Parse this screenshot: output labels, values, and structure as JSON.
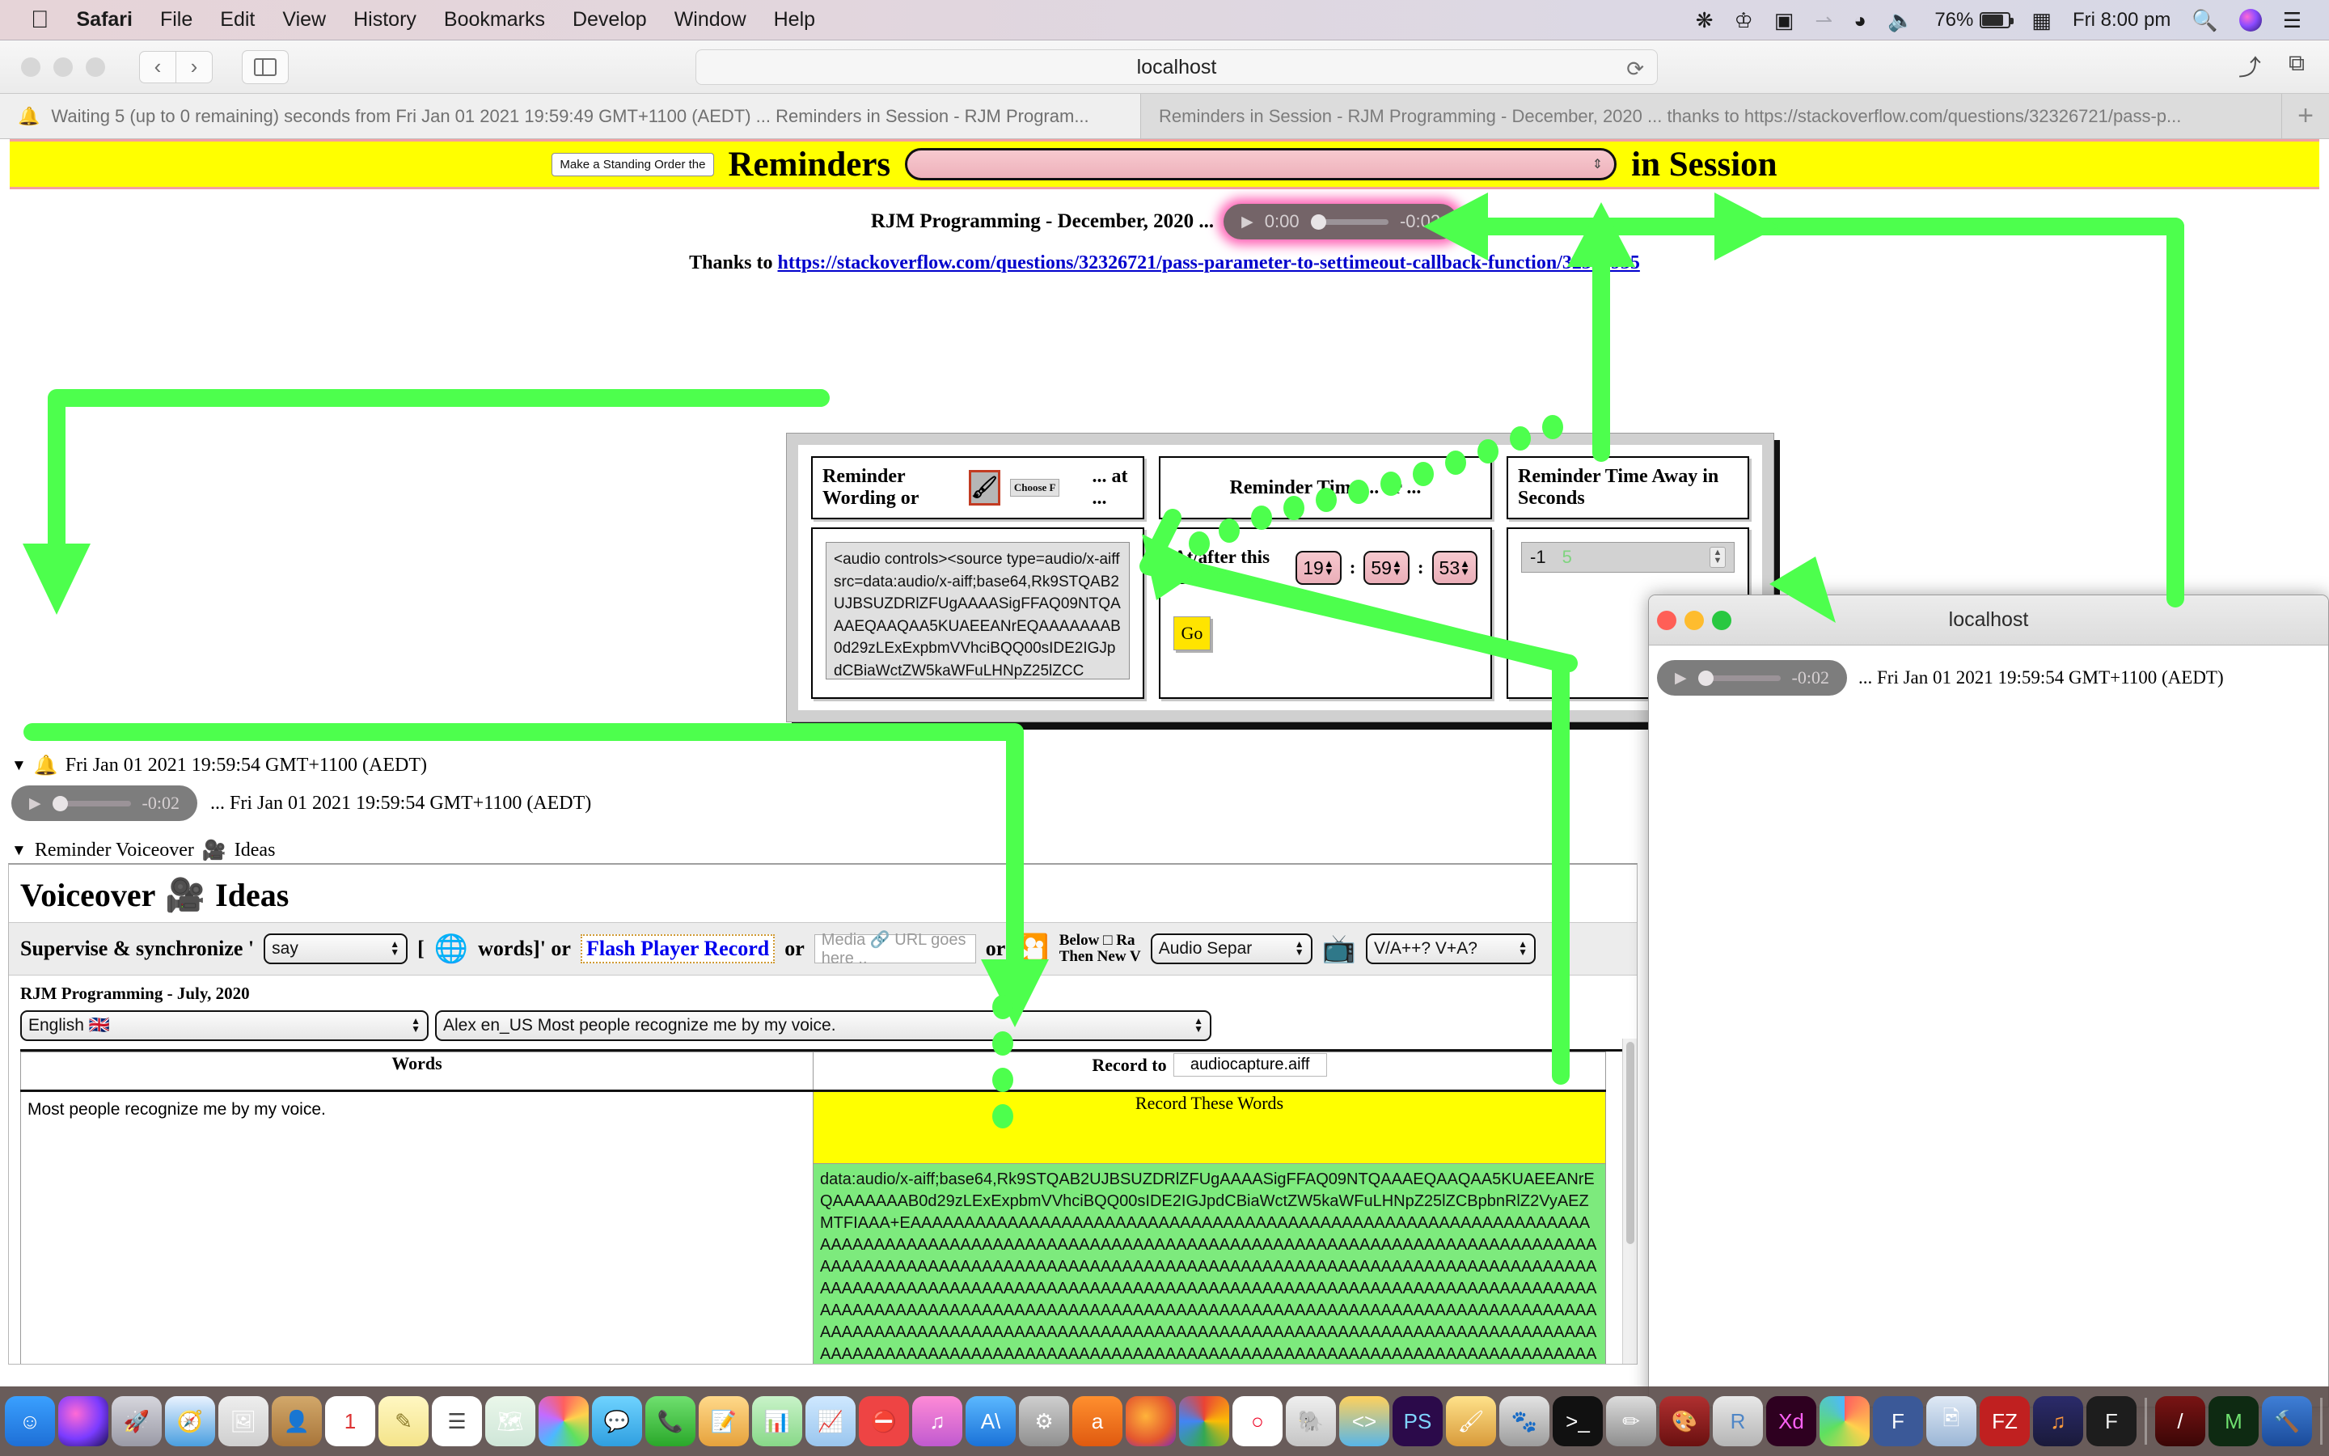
{
  "menubar": {
    "apple": "apple-logo",
    "items": [
      "Safari",
      "File",
      "Edit",
      "View",
      "History",
      "Bookmarks",
      "Develop",
      "Window",
      "Help"
    ],
    "battery_percent": "76%",
    "clock": "Fri 8:00 pm"
  },
  "toolbar": {
    "url": "localhost",
    "reload_glyph": "⟳",
    "back_glyph": "‹",
    "forward_glyph": "›",
    "share_glyph": "⤴",
    "tabs_glyph": "⧉"
  },
  "tabs": [
    {
      "favicon": "🔔",
      "label": "Waiting 5 (up to 0 remaining) seconds from Fri Jan 01 2021 19:59:49 GMT+1100 (AEDT) ... Reminders in Session - RJM Program...",
      "active": true
    },
    {
      "favicon": "",
      "label": "Reminders in Session - RJM Programming - December, 2020 ... thanks to https://stackoverflow.com/questions/32326721/pass-p...",
      "active": false
    }
  ],
  "new_tab_label": "+",
  "header": {
    "standing_order_button": "Make a Standing Order the",
    "title_left": "Reminders",
    "title_right": "in Session",
    "select_value": ""
  },
  "subheader": {
    "rjm_line": "RJM Programming - December, 2020 ...",
    "player": {
      "time_current": "0:00",
      "time_remaining": "-0:02"
    },
    "thanks_prefix": "Thanks to ",
    "thanks_link": "https://stackoverflow.com/questions/32326721/pass-parameter-to-settimeout-callback-function/32326935"
  },
  "panel": {
    "col1": {
      "heading": "Reminder Wording or",
      "brush_icon": "brush-icon",
      "choose_file": "Choose F",
      "at_text": "... at ...",
      "audio_code": "<audio controls><source type=audio/x-aiff src=data:audio/x-aiff;base64,Rk9STQAB2UJBSUZDRlZFUgAAAASigFFAQ09NTQAAAEQAAQAA5KUAEEANrEQAAAAAAAB0d29zLExExpbmVVhciBQQ00sIDE2IGJpdCBiaWctZW5kaWFuLHNpZ25lZCC"
    },
    "col2": {
      "heading": "Reminder Time ... or ...",
      "at_after_label": "At/after this time:",
      "hours": "19",
      "minutes": "59",
      "seconds": "53",
      "go_label": "Go"
    },
    "col3": {
      "heading": "Reminder Time Away in Seconds",
      "value": "-1",
      "placeholder": "5"
    }
  },
  "below": {
    "alarm_icon": "bell-icon",
    "timestamp": "Fri Jan 01 2021 19:59:54 GMT+1100 (AEDT)",
    "player": {
      "time_remaining": "-0:02"
    },
    "player_caption": "... Fri Jan 01 2021 19:59:54 GMT+1100 (AEDT)",
    "voiceover_toggle_prefix": "Reminder Voiceover",
    "voiceover_toggle_suffix": "Ideas",
    "camera_icon": "video-camera-icon"
  },
  "voiceover": {
    "title_prefix": "Voiceover",
    "title_suffix": "Ideas",
    "supervise_label": "Supervise & synchronize '",
    "say_select": "say",
    "bracket_open": "[",
    "globe_icon": "globe-icon",
    "words_label": "words]' or",
    "flash_player_record": "Flash Player Record",
    "or_1": "or",
    "media_url_placeholder": "Media 🔗 URL goes here ..",
    "or_2": "or",
    "film_icon": "film-reel-icon",
    "below_line1": "Below □ Ra",
    "below_line2": "Then New V",
    "audio_sep_select": "Audio Separ",
    "projector_icon": "projector-icon",
    "va_select": "V/A++? V+A?",
    "rjm_july": "RJM Programming - July, 2020",
    "language_select": "English 🇬🇧",
    "voice_select": "Alex en_US Most people recognize me by my voice.",
    "table": {
      "headers": {
        "words": "Words",
        "record_to_label": "Record to",
        "record_to_value": "audiocapture.aiff"
      },
      "words_value": "Most people recognize me by my voice.",
      "record_button": "Record These Words",
      "data_uri": "data:audio/x-aiff;base64,Rk9STQAB2UJBSUZDRlZFUgAAAASigFFAQ09NTQAAAEQAAQAA5KUAEEANrEQAAAAAAAB0d29zLExExpbmVVhciBQQ00sIDE2IGJpdCBiaWctZW5kaWFuLHNpZ25lZCBpbnRlZ2VyAEZMTFIAAA+EAAAAAAAAAAAAAAAAAAAAAAAAAAAAAAAAAAAAAAAAAAAAAAAAAAAAAAAAAAAAAAAAAAAAAAAAAAAAAAAAAAAAAAAAAAAAAAAAAAAAAAAAAAAAAAAAAAAAAAAAAAAAAAAAAAAAAAAAAAAAAAAAAAAAAAAAAAAAAAAAAAAAAAAAAAAAAAAAAAAAAAAAAAAAAAAAAAAAAAAAAAAAAAAAAAAAAAAAAAAAAAAAAAAAAAAAAAAAAAAAAAAAAAAAAAAAAAAAAAAAAAAAAAAAAAAAAAAAAAAAAAAAAAAAAAAAAAAAAAAAAAAAAAAAAAAAAAAAAAAAAAAAAAAAAAAAAAAAAAAAAAAAAAAAAAAAAAAAAAAAAAAAAAAAAAAAAAAAAAAAAAAAAAAAAAAAAAAAAAAAAAAAAAAAAAAAAAAAAAAAAAAAAAAAAAAAAAAAAAAAAAAAAAAAAAAAAAAAAAAAAAAAAAAAAAAAAAAAAAAAAAAAAAAAAAAAAAAAAAAAAAAAAAAAAAAAAAAAAAAAAAAAAAAAAAAAAAAAAAAAAAAAAAAAAAAAAAAAAAAAAAAAAAAAAAA"
    }
  },
  "window2": {
    "title": "localhost",
    "player": {
      "time_remaining": "-0:02"
    },
    "caption": "... Fri Jan 01 2021 19:59:54 GMT+1100 (AEDT)"
  },
  "colors": {
    "accent_yellow": "#ffff00",
    "annotation_green": "#4dff4d",
    "link_blue": "#0000cc",
    "pink_spinner": "#eeb1bb",
    "green_code": "#7dea7d"
  }
}
